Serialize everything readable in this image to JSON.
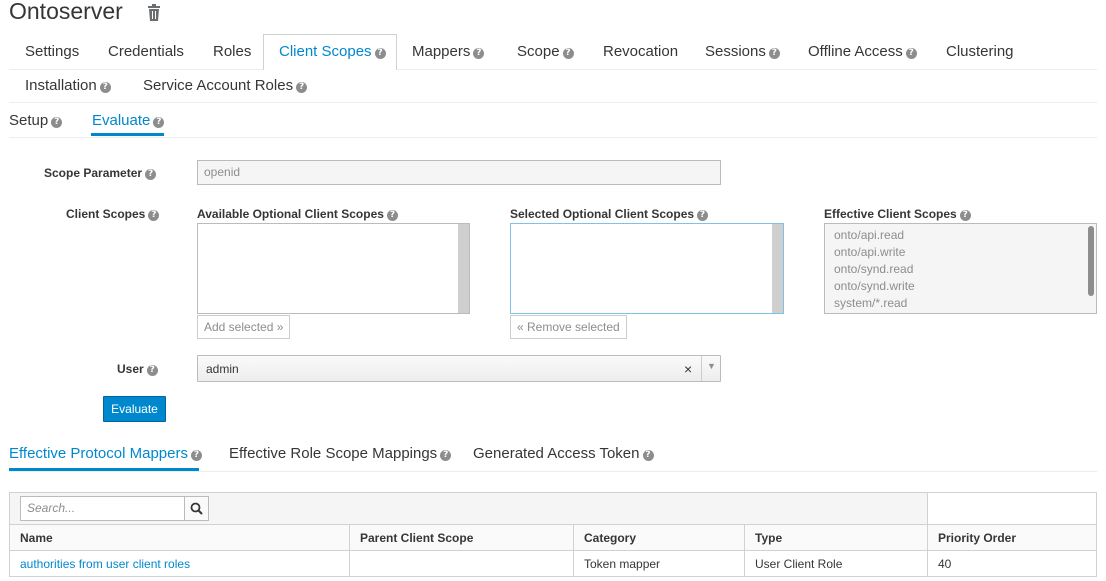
{
  "app": {
    "title": "Ontoserver"
  },
  "main_tabs": [
    {
      "label": "Settings",
      "help": false
    },
    {
      "label": "Credentials",
      "help": false
    },
    {
      "label": "Roles",
      "help": false
    },
    {
      "label": "Client Scopes",
      "help": true,
      "active": true
    },
    {
      "label": "Mappers",
      "help": true
    },
    {
      "label": "Scope",
      "help": true
    },
    {
      "label": "Revocation",
      "help": false
    },
    {
      "label": "Sessions",
      "help": true
    },
    {
      "label": "Offline Access",
      "help": true
    },
    {
      "label": "Clustering",
      "help": false
    },
    {
      "label": "Installation",
      "help": true
    },
    {
      "label": "Service Account Roles",
      "help": true
    }
  ],
  "sub_tabs": [
    {
      "label": "Setup",
      "active": false
    },
    {
      "label": "Evaluate",
      "active": true
    }
  ],
  "form": {
    "scope_parameter": {
      "label": "Scope Parameter",
      "value": "openid"
    },
    "client_scopes": {
      "label": "Client Scopes",
      "available_label": "Available Optional Client Scopes",
      "selected_label": "Selected Optional Client Scopes",
      "effective_label": "Effective Client Scopes",
      "add_button": "Add selected »",
      "remove_button": "« Remove selected",
      "effective_items": [
        "onto/api.read",
        "onto/api.write",
        "onto/synd.read",
        "onto/synd.write",
        "system/*.read"
      ]
    },
    "user": {
      "label": "User",
      "value": "admin",
      "clear": "×"
    },
    "evaluate_button": "Evaluate"
  },
  "bottom_tabs": [
    {
      "label": "Effective Protocol Mappers",
      "active": true
    },
    {
      "label": "Effective Role Scope Mappings",
      "active": false
    },
    {
      "label": "Generated Access Token",
      "active": false
    }
  ],
  "table": {
    "search_placeholder": "Search...",
    "columns": [
      "Name",
      "Parent Client Scope",
      "Category",
      "Type",
      "Priority Order"
    ],
    "rows": [
      {
        "name": "authorities from user client roles",
        "parent": "",
        "category": "Token mapper",
        "type": "User Client Role",
        "priority": "40"
      }
    ]
  },
  "colors": {
    "accent": "#0088ce",
    "primary_button": "#0088ce",
    "border": "#d1d1d1"
  }
}
